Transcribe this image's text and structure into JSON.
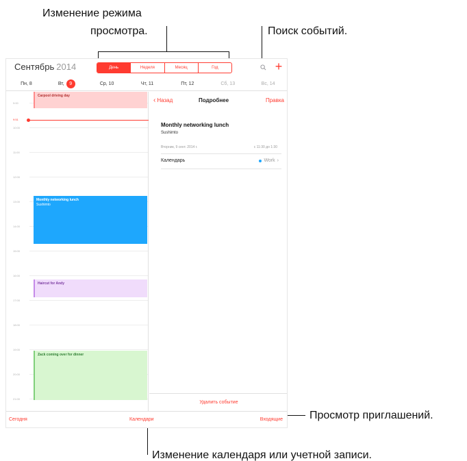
{
  "callouts": {
    "view_mode_line1": "Изменение режима",
    "view_mode_line2": "просмотра.",
    "search": "Поиск событий.",
    "invites": "Просмотр приглашений.",
    "calendar_account": "Изменение календаря или учетной записи."
  },
  "header": {
    "month": "Сентябрь",
    "year": "2014",
    "segments": [
      {
        "label": "День",
        "active": true
      },
      {
        "label": "Неделя",
        "active": false
      },
      {
        "label": "Месяц",
        "active": false
      },
      {
        "label": "Год",
        "active": false
      }
    ],
    "search_icon": "search-icon",
    "add_label": "+"
  },
  "days": [
    {
      "label": "Пн, 8"
    },
    {
      "label": "Вт,",
      "badge": "9"
    },
    {
      "label": "Ср, 10"
    },
    {
      "label": "Чт, 11"
    },
    {
      "label": "Пт, 12"
    },
    {
      "label": "Сб, 13"
    },
    {
      "label": "Вс, 14"
    }
  ],
  "timeline": {
    "hours": [
      "9:00",
      "10:00",
      "11:00",
      "12:00",
      "13:00",
      "14:00",
      "15:00",
      "16:00",
      "17:00",
      "18:00",
      "19:00",
      "20:00",
      "21:00"
    ],
    "now_label": "9:51"
  },
  "events": {
    "carpool": "Carpool driving day",
    "lunch_title": "Monthly networking lunch",
    "lunch_sub": "Sushimto",
    "haircut": "Haircut for Andy",
    "zack": "Zack coming over for dinner"
  },
  "detail": {
    "back": "Назад",
    "title": "Подробнее",
    "edit": "Правка",
    "event_name": "Monthly networking lunch",
    "location": "Sushimto",
    "date": "Вторник, 9 сент. 2014 г.",
    "time": "с 11:30 до 1:30",
    "calendar_label": "Календарь",
    "calendar_value": "Work",
    "delete": "Удалить событие"
  },
  "toolbar": {
    "today": "Сегодня",
    "calendars": "Календари",
    "inbox": "Входящие"
  },
  "colors": {
    "accent": "#ff3b30",
    "lunch": "#1ea7fd",
    "carpool": "#ffd2d2",
    "haircut": "#f0dcfb",
    "zack": "#d8f6d0"
  }
}
